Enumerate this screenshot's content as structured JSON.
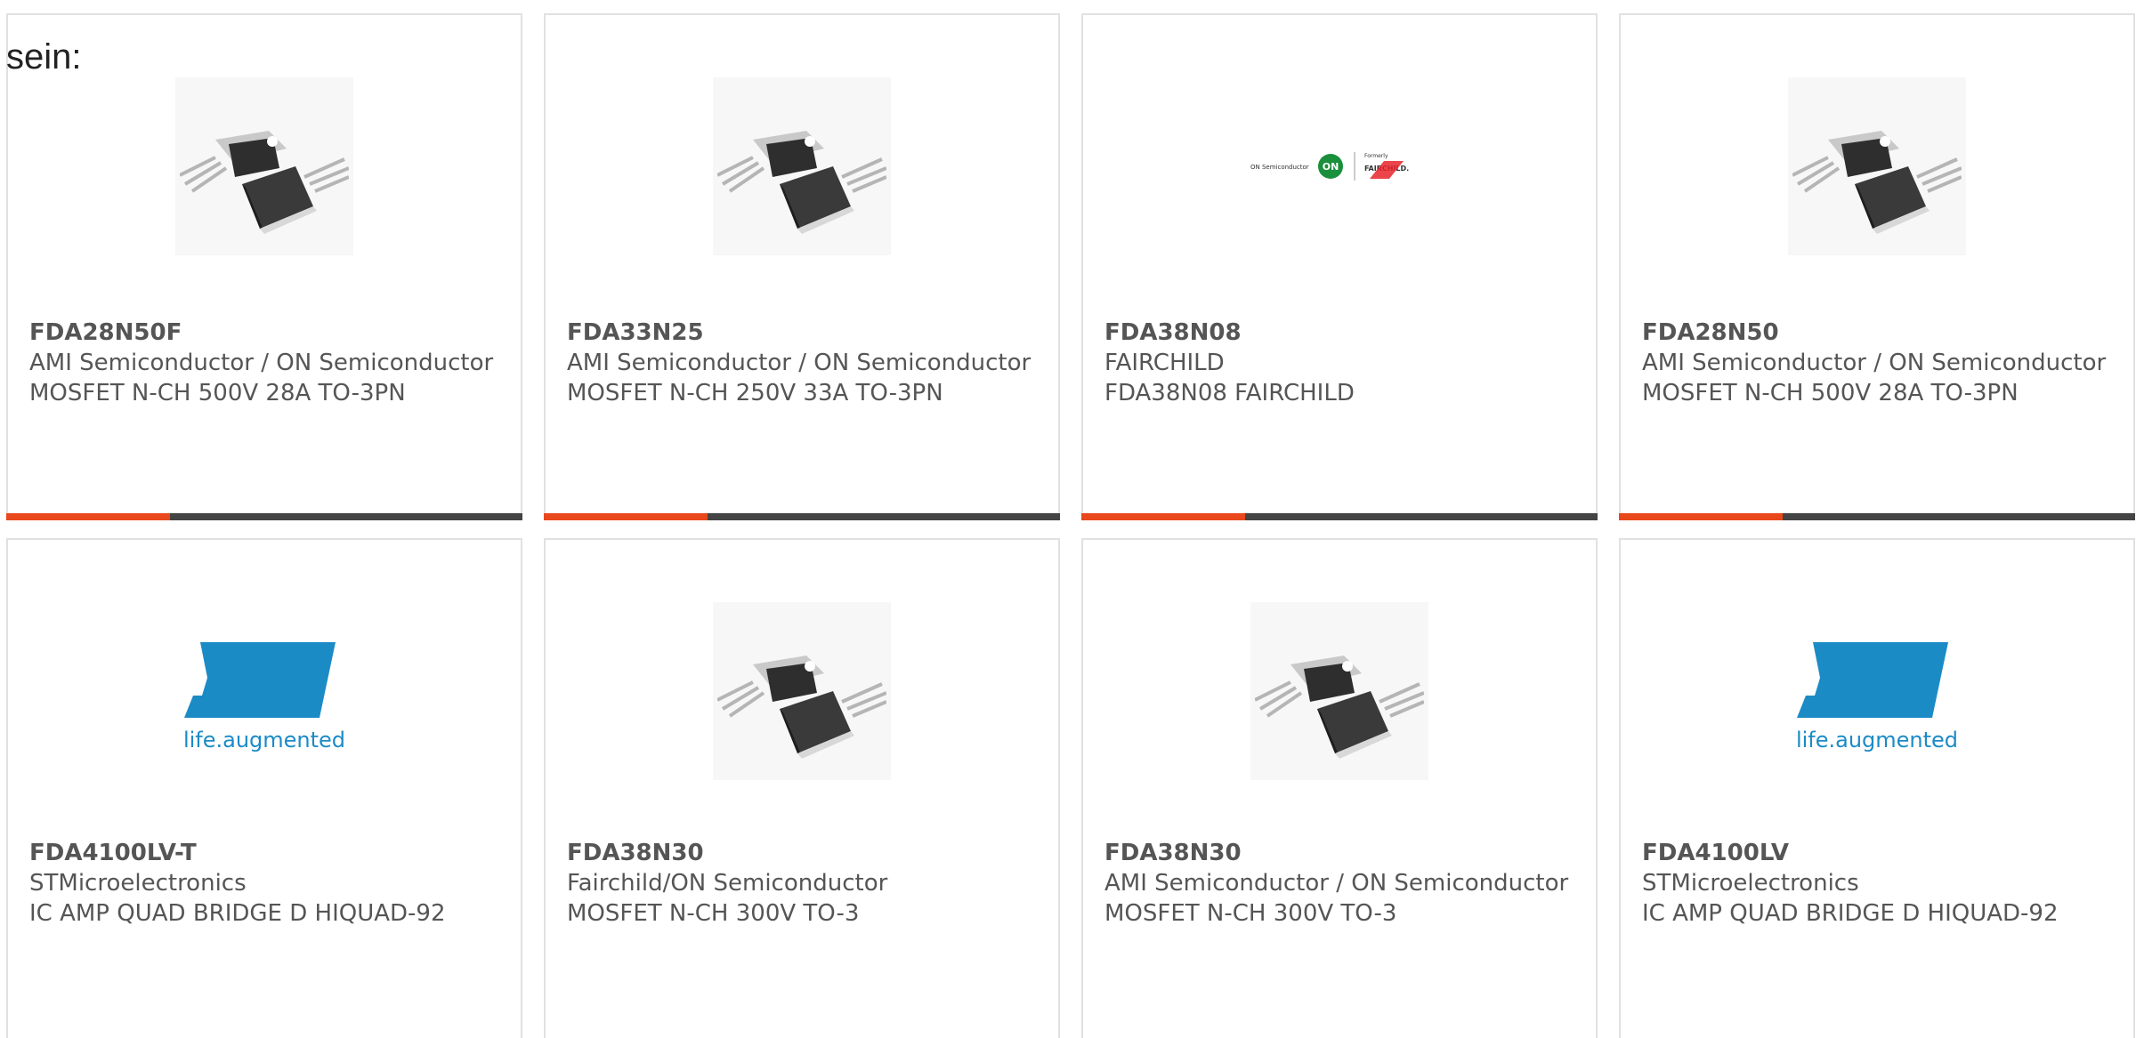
{
  "lead_text": "sein:",
  "colors": {
    "accent": "#e8481b",
    "bar": "#444444",
    "border": "#e1e1e1",
    "text": "#555555",
    "st_blue": "#1b8bc6"
  },
  "products": [
    {
      "part": "FDA28N50F",
      "manufacturer": "AMI Semiconductor / ON Semiconductor",
      "description": "MOSFET N-CH 500V 28A TO-3PN",
      "image": "transistor-to3p-icon"
    },
    {
      "part": "FDA33N25",
      "manufacturer": "AMI Semiconductor / ON Semiconductor",
      "description": "MOSFET N-CH 250V 33A TO-3PN",
      "image": "transistor-to3p-icon"
    },
    {
      "part": "FDA38N08",
      "manufacturer": "FAIRCHILD",
      "description": "FDA38N08 FAIRCHILD",
      "image": "on-fairchild-logo",
      "logo_text": {
        "on_semi": "ON Semiconductor",
        "on": "ON",
        "formerly": "Formerly",
        "fairchild": "FAIRCHILD."
      }
    },
    {
      "part": "FDA28N50",
      "manufacturer": "AMI Semiconductor / ON Semiconductor",
      "description": "MOSFET N-CH 500V 28A TO-3PN",
      "image": "transistor-to3p-icon"
    },
    {
      "part": "FDA4100LV-T",
      "manufacturer": "STMicroelectronics",
      "description": "IC AMP QUAD BRIDGE D HIQUAD-92",
      "image": "st-logo",
      "logo_text": {
        "tagline": "life.augmented"
      }
    },
    {
      "part": "FDA38N30",
      "manufacturer": "Fairchild/ON Semiconductor",
      "description": "MOSFET N-CH 300V TO-3",
      "image": "transistor-to3p-icon"
    },
    {
      "part": "FDA38N30",
      "manufacturer": "AMI Semiconductor / ON Semiconductor",
      "description": "MOSFET N-CH 300V TO-3",
      "image": "transistor-to3p-icon"
    },
    {
      "part": "FDA4100LV",
      "manufacturer": "STMicroelectronics",
      "description": "IC AMP QUAD BRIDGE D HIQUAD-92",
      "image": "st-logo",
      "logo_text": {
        "tagline": "life.augmented"
      }
    }
  ]
}
